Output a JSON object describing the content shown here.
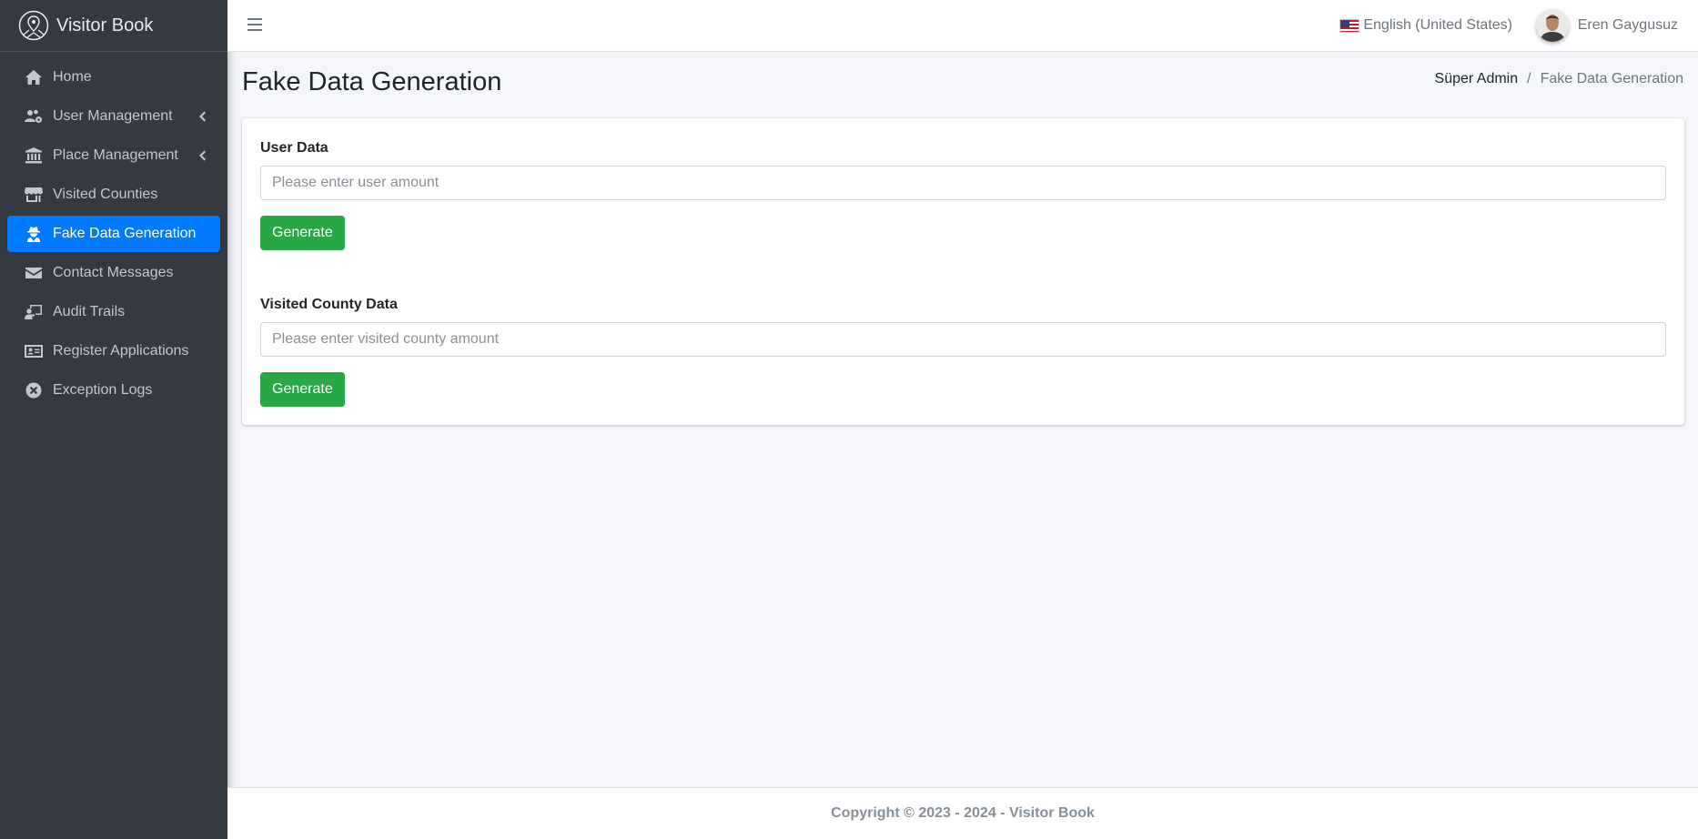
{
  "brand": {
    "name": "Visitor Book"
  },
  "sidebar": {
    "items": [
      {
        "label": "Home",
        "icon": "home-icon",
        "active": false,
        "has_submenu": false
      },
      {
        "label": "User Management",
        "icon": "users-cog-icon",
        "active": false,
        "has_submenu": true
      },
      {
        "label": "Place Management",
        "icon": "landmark-icon",
        "active": false,
        "has_submenu": true
      },
      {
        "label": "Visited Counties",
        "icon": "store-icon",
        "active": false,
        "has_submenu": false
      },
      {
        "label": "Fake Data Generation",
        "icon": "user-secret-icon",
        "active": true,
        "has_submenu": false
      },
      {
        "label": "Contact Messages",
        "icon": "envelope-icon",
        "active": false,
        "has_submenu": false
      },
      {
        "label": "Audit Trails",
        "icon": "chalkboard-user-icon",
        "active": false,
        "has_submenu": false
      },
      {
        "label": "Register Applications",
        "icon": "id-card-icon",
        "active": false,
        "has_submenu": false
      },
      {
        "label": "Exception Logs",
        "icon": "times-circle-icon",
        "active": false,
        "has_submenu": false
      }
    ]
  },
  "topbar": {
    "language": "English (United States)",
    "user_name": "Eren Gaygusuz"
  },
  "page": {
    "title": "Fake Data Generation",
    "breadcrumb": {
      "parent": "Süper Admin",
      "separator": "/",
      "current": "Fake Data Generation"
    }
  },
  "form": {
    "user_data": {
      "label": "User Data",
      "value": "",
      "placeholder": "Please enter user amount",
      "button_label": "Generate"
    },
    "visited_county_data": {
      "label": "Visited County Data",
      "value": "",
      "placeholder": "Please enter visited county amount",
      "button_label": "Generate"
    }
  },
  "footer": {
    "text": "Copyright © 2023 - 2024 - Visitor Book"
  },
  "colors": {
    "sidebar_bg": "#343a40",
    "active_item": "#007bff",
    "generate_button": "#28a745",
    "content_bg": "#f4f6f9"
  }
}
